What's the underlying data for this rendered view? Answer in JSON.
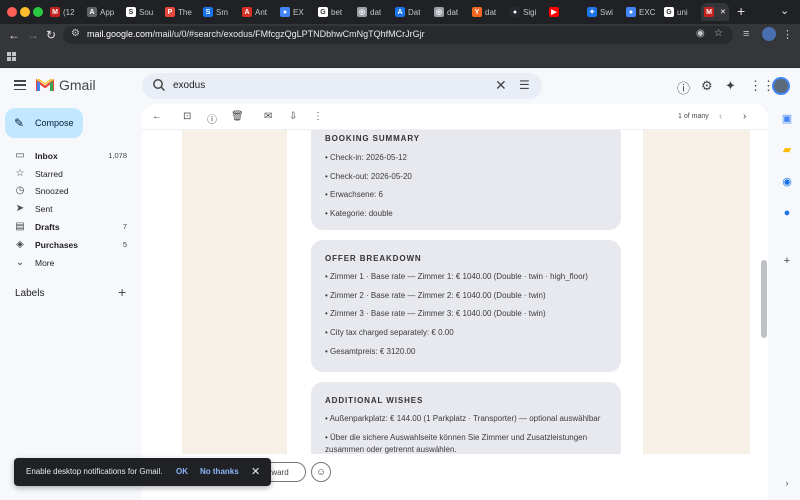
{
  "browser": {
    "tabs": [
      {
        "label": "(12",
        "icon": "gmail-icon",
        "color": "#c5221f",
        "glyph": "M"
      },
      {
        "label": "App",
        "icon": "app-icon",
        "color": "#5f6368",
        "glyph": "A"
      },
      {
        "label": "Sou",
        "icon": "source-icon",
        "color": "#ffffff",
        "glyph": "S"
      },
      {
        "label": "The",
        "icon": "the-icon",
        "color": "#e8453c",
        "glyph": "P"
      },
      {
        "label": "Sm",
        "icon": "sm-icon",
        "color": "#1a73e8",
        "glyph": "S"
      },
      {
        "label": "Ant",
        "icon": "anthropic-icon",
        "color": "#d93025",
        "glyph": "A"
      },
      {
        "label": "EX",
        "icon": "ex-icon",
        "color": "#4285f4",
        "glyph": "●"
      },
      {
        "label": "bet",
        "icon": "google-icon",
        "color": "#ffffff",
        "glyph": "G"
      },
      {
        "label": "dat",
        "icon": "globe-icon",
        "color": "#9aa0a6",
        "glyph": "◎"
      },
      {
        "label": "Dat",
        "icon": "dat-icon",
        "color": "#1a73e8",
        "glyph": "A"
      },
      {
        "label": "dat",
        "icon": "globe-icon",
        "color": "#9aa0a6",
        "glyph": "◎"
      },
      {
        "label": "dat",
        "icon": "yc-icon",
        "color": "#f26522",
        "glyph": "Y"
      },
      {
        "label": "Sigi",
        "icon": "github-icon",
        "color": "#24292f",
        "glyph": "●"
      },
      {
        "label": "",
        "icon": "youtube-icon",
        "color": "#ff0000",
        "glyph": "▶"
      },
      {
        "label": "Swi",
        "icon": "gemini-icon",
        "color": "#1a73e8",
        "glyph": "✦"
      },
      {
        "label": "EXC",
        "icon": "ex-icon",
        "color": "#4285f4",
        "glyph": "●"
      },
      {
        "label": "uni",
        "icon": "google-icon",
        "color": "#ffffff",
        "glyph": "G"
      },
      {
        "label": "",
        "icon": "gmail-icon",
        "color": "#c5221f",
        "glyph": "M",
        "active": true
      }
    ],
    "url_host": "mail.google.com",
    "url_path": "/mail/u/0/#search/exodus/FMfcgzQgLPTNDbhwCmNgTQhfMCrJrGjr"
  },
  "gmail": {
    "app_name": "Gmail",
    "search_value": "exodus",
    "pager": "1 of many",
    "compose_label": "Compose",
    "nav": [
      {
        "name": "inbox",
        "icon": "inbox-icon",
        "glyph": "▭",
        "label": "Inbox",
        "count": "1,078",
        "bold": true
      },
      {
        "name": "starred",
        "icon": "star-icon",
        "glyph": "☆",
        "label": "Starred",
        "count": ""
      },
      {
        "name": "snoozed",
        "icon": "clock-icon",
        "glyph": "◷",
        "label": "Snoozed",
        "count": ""
      },
      {
        "name": "sent",
        "icon": "send-icon",
        "glyph": "➤",
        "label": "Sent",
        "count": ""
      },
      {
        "name": "drafts",
        "icon": "draft-icon",
        "glyph": "▤",
        "label": "Drafts",
        "count": "7",
        "bold": true
      },
      {
        "name": "purchases",
        "icon": "tag-icon",
        "glyph": "◈",
        "label": "Purchases",
        "count": "5",
        "bold": true
      },
      {
        "name": "more",
        "icon": "chevron-down-icon",
        "glyph": "⌄",
        "label": "More",
        "count": ""
      }
    ],
    "labels_heading": "Labels"
  },
  "email": {
    "booking": {
      "title": "BOOKING SUMMARY",
      "lines": [
        "• Check-in: 2026-05-12",
        "• Check-out: 2026-05-20",
        "• Erwachsene: 6",
        "• Kategorie: double"
      ]
    },
    "offer": {
      "title": "OFFER BREAKDOWN",
      "lines": [
        "• Zimmer 1 · Base rate — Zimmer 1: € 1040.00 (Double · twin · high_floor)",
        "• Zimmer 2 · Base rate — Zimmer 2: € 1040.00 (Double · twin)",
        "• Zimmer 3 · Base rate — Zimmer 3: € 1040.00 (Double · twin)",
        "• City tax charged separately: € 0.00",
        "• Gesamtpreis: € 3120.00"
      ]
    },
    "wishes": {
      "title": "ADDITIONAL WISHES",
      "lines": [
        "• Außenparkplatz: € 144.00 (1 Parkplatz · Transporter) — optional auswählbar",
        "• Über die sichere Auswahlseite können Sie Zimmer und Zusatzleistungen",
        "  zusammen oder getrennt auswählen."
      ]
    },
    "forward_label": "Forward"
  },
  "toast": {
    "message": "Enable desktop notifications for Gmail.",
    "ok": "OK",
    "no_thanks": "No thanks"
  },
  "colors": {
    "accent": "#0b57d0",
    "compose_bg": "#c2e7ff",
    "card_bg": "#e8e9ee",
    "email_bg": "#f6f0e6"
  }
}
